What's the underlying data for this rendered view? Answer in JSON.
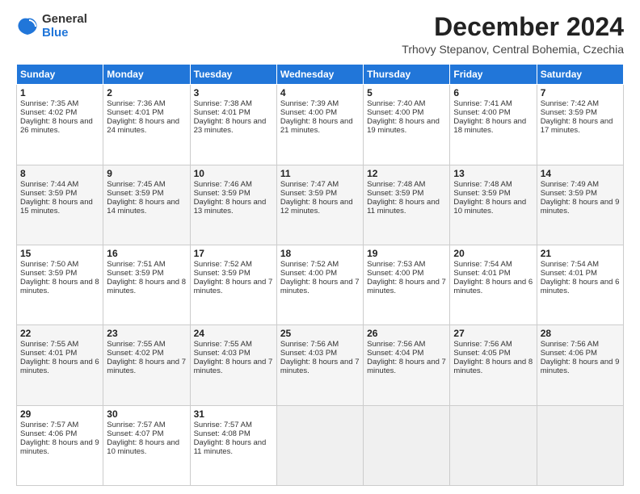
{
  "logo": {
    "general": "General",
    "blue": "Blue"
  },
  "title": "December 2024",
  "subtitle": "Trhovy Stepanov, Central Bohemia, Czechia",
  "headers": [
    "Sunday",
    "Monday",
    "Tuesday",
    "Wednesday",
    "Thursday",
    "Friday",
    "Saturday"
  ],
  "weeks": [
    [
      {
        "day": "1",
        "sunrise": "Sunrise: 7:35 AM",
        "sunset": "Sunset: 4:02 PM",
        "daylight": "Daylight: 8 hours and 26 minutes."
      },
      {
        "day": "2",
        "sunrise": "Sunrise: 7:36 AM",
        "sunset": "Sunset: 4:01 PM",
        "daylight": "Daylight: 8 hours and 24 minutes."
      },
      {
        "day": "3",
        "sunrise": "Sunrise: 7:38 AM",
        "sunset": "Sunset: 4:01 PM",
        "daylight": "Daylight: 8 hours and 23 minutes."
      },
      {
        "day": "4",
        "sunrise": "Sunrise: 7:39 AM",
        "sunset": "Sunset: 4:00 PM",
        "daylight": "Daylight: 8 hours and 21 minutes."
      },
      {
        "day": "5",
        "sunrise": "Sunrise: 7:40 AM",
        "sunset": "Sunset: 4:00 PM",
        "daylight": "Daylight: 8 hours and 19 minutes."
      },
      {
        "day": "6",
        "sunrise": "Sunrise: 7:41 AM",
        "sunset": "Sunset: 4:00 PM",
        "daylight": "Daylight: 8 hours and 18 minutes."
      },
      {
        "day": "7",
        "sunrise": "Sunrise: 7:42 AM",
        "sunset": "Sunset: 3:59 PM",
        "daylight": "Daylight: 8 hours and 17 minutes."
      }
    ],
    [
      {
        "day": "8",
        "sunrise": "Sunrise: 7:44 AM",
        "sunset": "Sunset: 3:59 PM",
        "daylight": "Daylight: 8 hours and 15 minutes."
      },
      {
        "day": "9",
        "sunrise": "Sunrise: 7:45 AM",
        "sunset": "Sunset: 3:59 PM",
        "daylight": "Daylight: 8 hours and 14 minutes."
      },
      {
        "day": "10",
        "sunrise": "Sunrise: 7:46 AM",
        "sunset": "Sunset: 3:59 PM",
        "daylight": "Daylight: 8 hours and 13 minutes."
      },
      {
        "day": "11",
        "sunrise": "Sunrise: 7:47 AM",
        "sunset": "Sunset: 3:59 PM",
        "daylight": "Daylight: 8 hours and 12 minutes."
      },
      {
        "day": "12",
        "sunrise": "Sunrise: 7:48 AM",
        "sunset": "Sunset: 3:59 PM",
        "daylight": "Daylight: 8 hours and 11 minutes."
      },
      {
        "day": "13",
        "sunrise": "Sunrise: 7:48 AM",
        "sunset": "Sunset: 3:59 PM",
        "daylight": "Daylight: 8 hours and 10 minutes."
      },
      {
        "day": "14",
        "sunrise": "Sunrise: 7:49 AM",
        "sunset": "Sunset: 3:59 PM",
        "daylight": "Daylight: 8 hours and 9 minutes."
      }
    ],
    [
      {
        "day": "15",
        "sunrise": "Sunrise: 7:50 AM",
        "sunset": "Sunset: 3:59 PM",
        "daylight": "Daylight: 8 hours and 8 minutes."
      },
      {
        "day": "16",
        "sunrise": "Sunrise: 7:51 AM",
        "sunset": "Sunset: 3:59 PM",
        "daylight": "Daylight: 8 hours and 8 minutes."
      },
      {
        "day": "17",
        "sunrise": "Sunrise: 7:52 AM",
        "sunset": "Sunset: 3:59 PM",
        "daylight": "Daylight: 8 hours and 7 minutes."
      },
      {
        "day": "18",
        "sunrise": "Sunrise: 7:52 AM",
        "sunset": "Sunset: 4:00 PM",
        "daylight": "Daylight: 8 hours and 7 minutes."
      },
      {
        "day": "19",
        "sunrise": "Sunrise: 7:53 AM",
        "sunset": "Sunset: 4:00 PM",
        "daylight": "Daylight: 8 hours and 7 minutes."
      },
      {
        "day": "20",
        "sunrise": "Sunrise: 7:54 AM",
        "sunset": "Sunset: 4:01 PM",
        "daylight": "Daylight: 8 hours and 6 minutes."
      },
      {
        "day": "21",
        "sunrise": "Sunrise: 7:54 AM",
        "sunset": "Sunset: 4:01 PM",
        "daylight": "Daylight: 8 hours and 6 minutes."
      }
    ],
    [
      {
        "day": "22",
        "sunrise": "Sunrise: 7:55 AM",
        "sunset": "Sunset: 4:01 PM",
        "daylight": "Daylight: 8 hours and 6 minutes."
      },
      {
        "day": "23",
        "sunrise": "Sunrise: 7:55 AM",
        "sunset": "Sunset: 4:02 PM",
        "daylight": "Daylight: 8 hours and 7 minutes."
      },
      {
        "day": "24",
        "sunrise": "Sunrise: 7:55 AM",
        "sunset": "Sunset: 4:03 PM",
        "daylight": "Daylight: 8 hours and 7 minutes."
      },
      {
        "day": "25",
        "sunrise": "Sunrise: 7:56 AM",
        "sunset": "Sunset: 4:03 PM",
        "daylight": "Daylight: 8 hours and 7 minutes."
      },
      {
        "day": "26",
        "sunrise": "Sunrise: 7:56 AM",
        "sunset": "Sunset: 4:04 PM",
        "daylight": "Daylight: 8 hours and 7 minutes."
      },
      {
        "day": "27",
        "sunrise": "Sunrise: 7:56 AM",
        "sunset": "Sunset: 4:05 PM",
        "daylight": "Daylight: 8 hours and 8 minutes."
      },
      {
        "day": "28",
        "sunrise": "Sunrise: 7:56 AM",
        "sunset": "Sunset: 4:06 PM",
        "daylight": "Daylight: 8 hours and 9 minutes."
      }
    ],
    [
      {
        "day": "29",
        "sunrise": "Sunrise: 7:57 AM",
        "sunset": "Sunset: 4:06 PM",
        "daylight": "Daylight: 8 hours and 9 minutes."
      },
      {
        "day": "30",
        "sunrise": "Sunrise: 7:57 AM",
        "sunset": "Sunset: 4:07 PM",
        "daylight": "Daylight: 8 hours and 10 minutes."
      },
      {
        "day": "31",
        "sunrise": "Sunrise: 7:57 AM",
        "sunset": "Sunset: 4:08 PM",
        "daylight": "Daylight: 8 hours and 11 minutes."
      },
      null,
      null,
      null,
      null
    ]
  ]
}
